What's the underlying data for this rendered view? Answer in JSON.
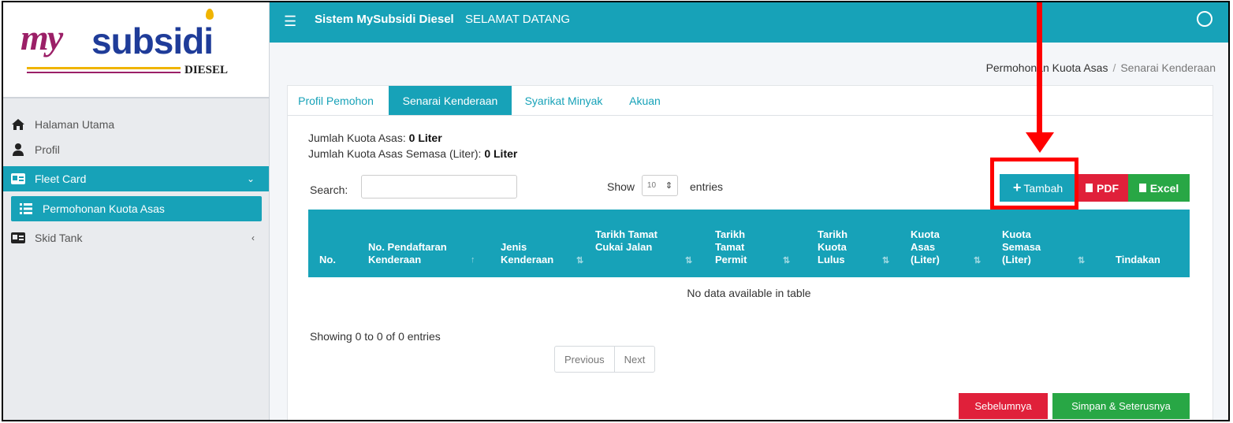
{
  "logo": {
    "brand_prefix": "my",
    "brand_main": "subsidi",
    "brand_sub": "DIESEL"
  },
  "topbar": {
    "title": "Sistem MySubsidi Diesel",
    "subtitle": "SELAMAT DATANG"
  },
  "sidebar": {
    "items": [
      {
        "label": "Halaman Utama"
      },
      {
        "label": "Profil"
      },
      {
        "label": "Fleet Card"
      },
      {
        "label": "Permohonan Kuota Asas"
      },
      {
        "label": "Skid Tank"
      }
    ]
  },
  "breadcrumb": {
    "parent": "Permohonan Kuota Asas",
    "separator": "/",
    "current": "Senarai Kenderaan"
  },
  "tabs": [
    "Profil Pemohon",
    "Senarai Kenderaan",
    "Syarikat Minyak",
    "Akuan"
  ],
  "quota": {
    "line1_label": "Jumlah Kuota Asas:",
    "line1_value": "0 Liter",
    "line2_label": "Jumlah Kuota Asas Semasa (Liter):",
    "line2_value": "0 Liter"
  },
  "table_controls": {
    "search_label": "Search:",
    "show_label": "Show",
    "show_value": "10",
    "entries_label": "entries"
  },
  "buttons": {
    "tambah": "Tambah",
    "pdf": "PDF",
    "excel": "Excel",
    "sebelumnya": "Sebelumnya",
    "simpan": "Simpan & Seterusnya"
  },
  "table": {
    "headers": [
      "No.",
      "No. Pendaftaran Kenderaan",
      "Jenis Kenderaan",
      "Tarikh Tamat Cukai Jalan",
      "Tarikh Tamat Permit",
      "Tarikh Kuota Lulus",
      "Kuota Asas (Liter)",
      "Kuota Semasa (Liter)",
      "Tindakan"
    ],
    "empty_message": "No data available in table",
    "info": "Showing 0 to 0 of 0 entries"
  },
  "pagination": {
    "previous": "Previous",
    "next": "Next"
  },
  "colors": {
    "primary": "#17a2b8",
    "danger": "#e0203a",
    "success": "#28a745",
    "annotation": "#ff0000"
  }
}
